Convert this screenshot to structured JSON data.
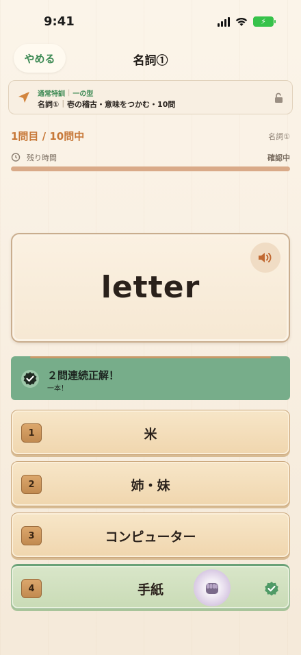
{
  "status_bar": {
    "time": "9:41"
  },
  "header": {
    "quit_label": "やめる",
    "title": "名詞①"
  },
  "info": {
    "mode": "通常特訓",
    "form": "一の型",
    "category": "名詞①",
    "detail": "壱の稽古・意味をつかむ・10問"
  },
  "progress": {
    "question_count": "1問目 / 10問中",
    "category": "名詞①",
    "remaining_label": "残り時間",
    "status": "確認中",
    "time_fraction": 1.0
  },
  "question": {
    "word": "letter"
  },
  "streak": {
    "title": "２問連続正解！",
    "subtitle": "一本！"
  },
  "choices": [
    {
      "number": "1",
      "text": "米"
    },
    {
      "number": "2",
      "text": "姉・妹"
    },
    {
      "number": "3",
      "text": "コンピューター"
    },
    {
      "number": "4",
      "text": "手紙"
    }
  ],
  "colors": {
    "accent_green": "#3d8a54",
    "accent_orange": "#c77838",
    "banner_green": "#77ad8a"
  },
  "icons": [
    "navigation-arrow-icon",
    "unlock-icon",
    "timer-icon",
    "speaker-icon",
    "check-badge-icon",
    "fist-icon"
  ]
}
